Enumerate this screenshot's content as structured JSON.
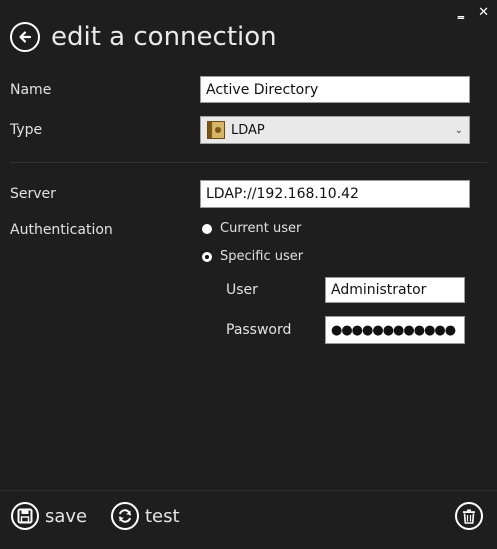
{
  "window": {
    "minimize_glyph": "‗",
    "close_glyph": "✕"
  },
  "header": {
    "title": "edit a connection"
  },
  "form": {
    "name_label": "Name",
    "name_value": "Active Directory",
    "type_label": "Type",
    "type_value": "LDAP",
    "server_label": "Server",
    "server_value": "LDAP://192.168.10.42",
    "authentication_label": "Authentication",
    "auth_options": [
      {
        "label": "Current user",
        "selected": false
      },
      {
        "label": "Specific user",
        "selected": true
      }
    ],
    "user_label": "User",
    "user_value": "Administrator",
    "password_label": "Password",
    "password_value": "●●●●●●●●●●●●"
  },
  "actions": {
    "save_label": "save",
    "test_label": "test"
  },
  "colors": {
    "background": "#1e1e1e",
    "text": "#e8e8e8",
    "field": "#ffffff"
  }
}
